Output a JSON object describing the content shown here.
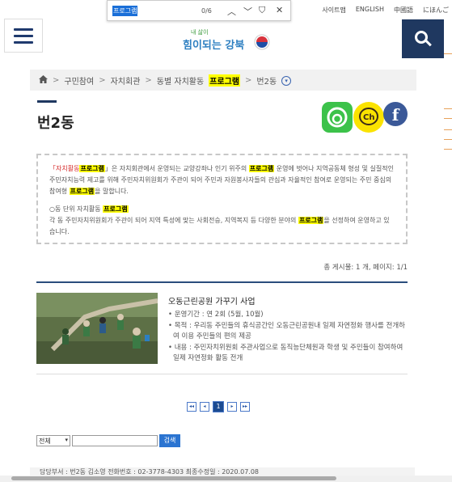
{
  "header": {
    "links": [
      "사이트맵",
      "ENGLISH",
      "中國語",
      "にほんご"
    ],
    "logo_top": "내 삶이",
    "logo_main": "힘이되는 강북"
  },
  "findbar": {
    "query": "프로그램",
    "count": "0/6"
  },
  "breadcrumb": {
    "items": [
      "구민참여",
      "자치회관",
      "동별 자치활동",
      "프로그램",
      "번2동"
    ]
  },
  "page": {
    "title": "번2동"
  },
  "info": {
    "p1_tag": "「자치활동",
    "p1_keyword": "프로그램",
    "p1_a": "」은 자치회관에서 운영되는 교양강좌나 인기 위주의",
    "p1_keyword2": "프로그램",
    "p1_b": "운영에 벗어나 지역공동체 형성 및 실질적인 주민자치능력 제고를 위해 주민자치위원회가 주관이 되어 주민과 자원봉사자들의 관심과 자율적인 참여로 운영되는 주민 중심의 참여형",
    "p1_keyword3": "프로그램",
    "p1_c": "을 말합니다.",
    "p2_head": "○동 단위 자치활동",
    "p2_keyword": "프로그램",
    "p2_a": "각 동 주민자치위원회가 주관이 되어 지역 특성에 맞는 사회전승, 지역복지 등 다양한 분야의",
    "p2_keyword2": "프로그램",
    "p2_b": "을 선정하여 운영하고 있습니다."
  },
  "list": {
    "count_text": "총 게시물: 1 개, 페이지: 1/1",
    "items": [
      {
        "title": "오동근린공원 가꾸기 사업",
        "period": "• 운영기간 : 연 2회 (5월, 10월)",
        "purpose": "• 목적 : 우리동 주민들의 휴식공간인 오동근린공원내 일제 자연정화 행사를 전개하여 이용 주민들의 편의 제공",
        "content": "• 내용 : 주민자치위원회 주관사업으로 동직능단체원과 학생 및 주민들이 참여하여 일제 자연정화 활동 전개"
      }
    ]
  },
  "pager": {
    "first": "◂◂",
    "prev": "◂",
    "current": "1",
    "next": "▸",
    "last": "▸▸"
  },
  "search": {
    "select": "전체",
    "button": "검색"
  },
  "footer": {
    "text": "담당부서 : 번2동 김소영    전화번호 : 02-3778-4303    최종수정일 : 2020.07.08"
  },
  "sns": {
    "kakao": "Ch",
    "facebook": "f"
  },
  "colors": {
    "navy": "#1f3860",
    "highlight": "#ffff00",
    "accent_blue": "#2b74d1"
  }
}
